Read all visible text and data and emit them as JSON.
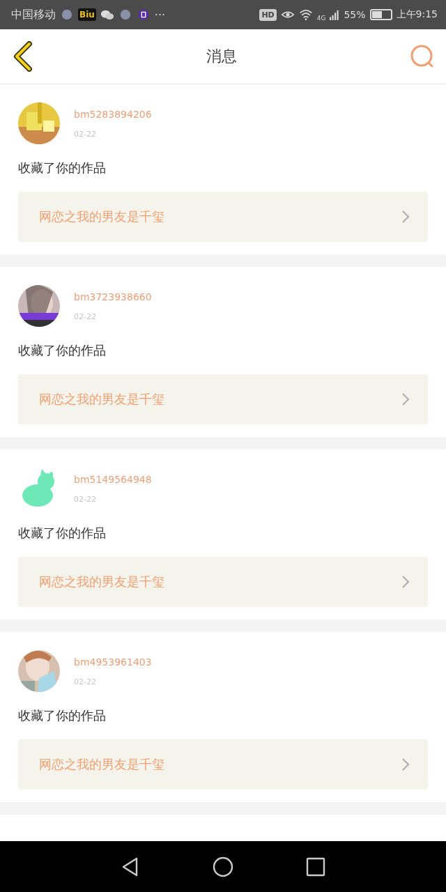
{
  "status_bar": {
    "carrier": "中国移动",
    "app_badge": "Biu",
    "more": "···",
    "hd": "HD",
    "network": "4G",
    "battery_text": "55%",
    "time": "上午9:15"
  },
  "header": {
    "title": "消息"
  },
  "messages": [
    {
      "user": "bm5283894206",
      "date": "02-22",
      "action": "收藏了你的作品",
      "work": "网恋之我的男友是千玺"
    },
    {
      "user": "bm3723938660",
      "date": "02-22",
      "action": "收藏了你的作品",
      "work": "网恋之我的男友是千玺"
    },
    {
      "user": "bm5149564948",
      "date": "02-22",
      "action": "收藏了你的作品",
      "work": "网恋之我的男友是千玺"
    },
    {
      "user": "bm4953961403",
      "date": "02-22",
      "action": "收藏了你的作品",
      "work": "网恋之我的男友是千玺"
    }
  ]
}
